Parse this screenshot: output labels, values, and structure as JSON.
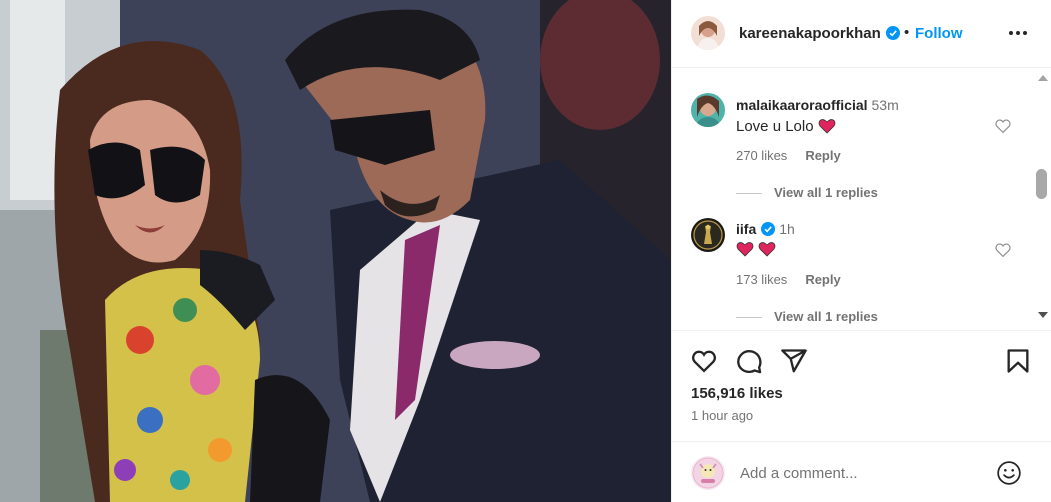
{
  "post": {
    "author": "kareenakapoorkhan",
    "follow_sep": "•",
    "follow_label": "Follow"
  },
  "comments": [
    {
      "user": "malaikaaroraofficial",
      "time": "53m",
      "text": "Love u Lolo",
      "likes": "270 likes",
      "reply_label": "Reply",
      "view_replies": "View all 1 replies"
    },
    {
      "user": "iifa",
      "time": "1h",
      "text": "",
      "likes": "173 likes",
      "reply_label": "Reply",
      "view_replies": "View all 1 replies"
    }
  ],
  "stats": {
    "likes": "156,916 likes",
    "posted": "1 hour ago"
  },
  "composer": {
    "placeholder": "Add a comment..."
  },
  "icons": {
    "verified": "verified-badge-icon",
    "like": "heart-icon",
    "comment": "comment-icon",
    "share": "share-icon",
    "save": "bookmark-icon",
    "more": "more-options-icon",
    "emoji": "emoji-icon"
  },
  "colors": {
    "accent": "#0095f6",
    "emoji_heart": "#e0245e"
  }
}
